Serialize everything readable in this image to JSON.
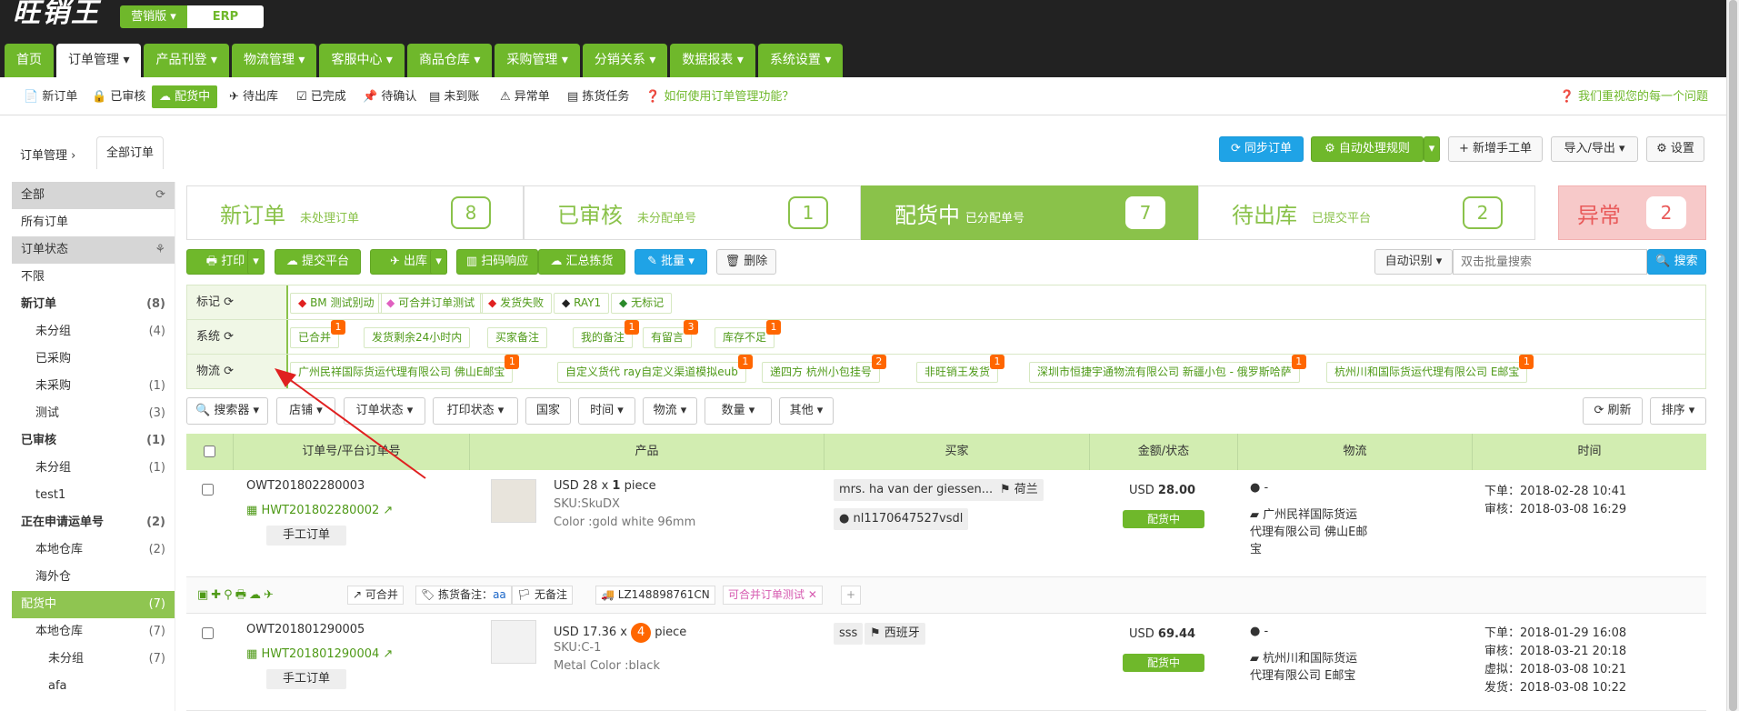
{
  "header": {
    "logo": "旺销王",
    "edition": "营销版 ▾",
    "erp": "ERP",
    "nav": [
      "首页",
      "订单管理 ▾",
      "产品刊登 ▾",
      "物流管理 ▾",
      "客服中心 ▾",
      "商品仓库 ▾",
      "采购管理 ▾",
      "分销关系 ▾",
      "数据报表 ▾",
      "系统设置 ▾"
    ]
  },
  "subnav": {
    "items": [
      "📄 新订单",
      "🔒 已审核",
      "☁ 配货中",
      "✈ 待出库",
      "☑ 已完成",
      "📌 待确认",
      "▤ 未到账",
      "⚠ 异常单",
      "▤ 拣货任务",
      "❓ 如何使用订单管理功能？"
    ],
    "help_right": "❓ 我们重视您的每一个问题"
  },
  "toolbar": {
    "breadcrumb": "订单管理",
    "tab": "全部订单",
    "sync": "⟳ 同步订单",
    "auto_rule": "⚙ 自动处理规则",
    "auto_rule_caret": "▾",
    "new_manual": "+ 新增手工单",
    "import_export": "导入/导出 ▾",
    "settings": "⚙ 设置"
  },
  "sidebar": [
    {
      "label": "全部",
      "count": "⟳",
      "type": "hdr"
    },
    {
      "label": "所有订单",
      "count": "",
      "type": ""
    },
    {
      "label": "订单状态",
      "count": "⚘",
      "type": "hdr"
    },
    {
      "label": "不限",
      "count": "",
      "type": ""
    },
    {
      "label": "新订单",
      "count": "(8)",
      "type": "bold"
    },
    {
      "label": "未分组",
      "count": "(4)",
      "type": "l2"
    },
    {
      "label": "已采购",
      "count": "",
      "type": "l2"
    },
    {
      "label": "未采购",
      "count": "(1)",
      "type": "l2"
    },
    {
      "label": "测试",
      "count": "(3)",
      "type": "l2"
    },
    {
      "label": "已审核",
      "count": "(1)",
      "type": "bold"
    },
    {
      "label": "未分组",
      "count": "(1)",
      "type": "l2"
    },
    {
      "label": "test1",
      "count": "",
      "type": "l2"
    },
    {
      "label": "正在申请运单号",
      "count": "(2)",
      "type": "bold"
    },
    {
      "label": "本地仓库",
      "count": "(2)",
      "type": "l2"
    },
    {
      "label": "海外仓",
      "count": "",
      "type": "l2"
    },
    {
      "label": "配货中",
      "count": "(7)",
      "type": "sel"
    },
    {
      "label": "本地仓库",
      "count": "(7)",
      "type": "l2"
    },
    {
      "label": "未分组",
      "count": "(7)",
      "type": "l3"
    },
    {
      "label": "afa",
      "count": "",
      "type": "l3"
    }
  ],
  "steps": [
    {
      "title": "新订单",
      "sub": "未处理订单",
      "num": "8"
    },
    {
      "title": "已审核",
      "sub": "未分配单号",
      "num": "1"
    },
    {
      "title": "配货中",
      "sub": "已分配单号",
      "num": "7"
    },
    {
      "title": "待出库",
      "sub": "已提交平台",
      "num": "2"
    },
    {
      "title": "异常",
      "sub": "",
      "num": "2"
    }
  ],
  "actions": {
    "print": "🖶 打印",
    "submit": "☁ 提交平台",
    "ship": "✈ 出库",
    "scan": "▥ 扫码响应",
    "summary": "☁ 汇总拣货",
    "batch": "✎ 批量 ▾",
    "delete": "🗑 删除",
    "auto_detect": "自动识别 ▾",
    "search_placeholder": "双击批量搜索",
    "search": "🔍 搜索",
    "caret": "▾"
  },
  "filters": {
    "mark_label": "标记 ⟳",
    "marks": [
      "BM 测试别动",
      "可合并订单测试",
      "发货失败",
      "RAY1",
      "无标记"
    ],
    "mark_colors": [
      "#e02020",
      "#e060c0",
      "#e02020",
      "#222222",
      "#2a8a2a"
    ],
    "sys_label": "系统 ⟳",
    "sys": [
      {
        "t": "已合并",
        "b": "1"
      },
      {
        "t": "发货剩余24小时内",
        "b": ""
      },
      {
        "t": "买家备注",
        "b": ""
      },
      {
        "t": "我的备注",
        "b": "1"
      },
      {
        "t": "有留言",
        "b": "3"
      },
      {
        "t": "库存不足",
        "b": "1"
      }
    ],
    "log_label": "物流 ⟳",
    "log": [
      {
        "t": "广州民祥国际货运代理有限公司 佛山E邮宝",
        "b": "1"
      },
      {
        "t": "自定义货代 ray自定义渠道模拟eub",
        "b": "1"
      },
      {
        "t": "递四方 杭州小包挂号",
        "b": "2"
      },
      {
        "t": "非旺销王发货",
        "b": "1"
      },
      {
        "t": "深圳市恒捷宇通物流有限公司 新疆小包 - 俄罗斯哈萨",
        "b": "1"
      },
      {
        "t": "杭州川和国际货运代理有限公司 E邮宝",
        "b": "1"
      }
    ]
  },
  "dropdowns": [
    "🔍 搜索器 ▾",
    "店铺 ▾",
    "订单状态 ▾",
    "打印状态 ▾",
    "国家",
    "时间 ▾",
    "物流 ▾",
    "数量 ▾",
    "其他 ▾"
  ],
  "right_dd": {
    "refresh": "⟳ 刷新",
    "sort": "排序 ▾"
  },
  "table": {
    "headers": [
      "",
      "订单号/平台订单号",
      "产品",
      "买家",
      "金额/状态",
      "物流",
      "时间"
    ],
    "rows": [
      {
        "order": "OWT201802280003",
        "platform": "HWT201802280002",
        "manual": "手工订单",
        "price": "USD 28 x",
        "qty": "1",
        "unit": "piece",
        "sku": "SKU:SkuDX",
        "attr": "Color :gold white 96mm",
        "buyer": "mrs. ha van der giessen...",
        "country": "荷兰",
        "buyer_id": "nl1170647527vsdl",
        "amount_cur": "USD",
        "amount": "28.00",
        "status": "配货中",
        "log_person": "-",
        "log_name": "广州民祥国际货运代理有限公司 佛山E邮宝",
        "times": [
          "下单：2018-02-28 10:41",
          "审核：2018-03-08 16:29"
        ]
      },
      {
        "order": "OWT201801290005",
        "platform": "HWT201801290004",
        "manual": "手工订单",
        "price": "USD 17.36 x",
        "qty": "4",
        "unit": "piece",
        "sku": "SKU:C-1",
        "attr": "Metal Color :black",
        "buyer": "sss",
        "country": "西班牙",
        "buyer_id": "",
        "amount_cur": "USD",
        "amount": "69.44",
        "status": "配货中",
        "log_person": "-",
        "log_name": "杭州川和国际货运代理有限公司 E邮宝",
        "times": [
          "下单：2018-01-29 16:08",
          "审核：2018-03-21 20:18",
          "虚拟：2018-03-08 10:21",
          "发货：2018-03-08 10:22"
        ]
      }
    ],
    "row_tools": {
      "merge": "↗ 可合并",
      "note_label": "🏷 拣货备注：",
      "note_val": "aa",
      "no_note": "🏳 无备注",
      "tracking": "🚚 LZ148898761CN",
      "merge_test": "可合并订单测试 ✕",
      "plus": "+"
    }
  }
}
